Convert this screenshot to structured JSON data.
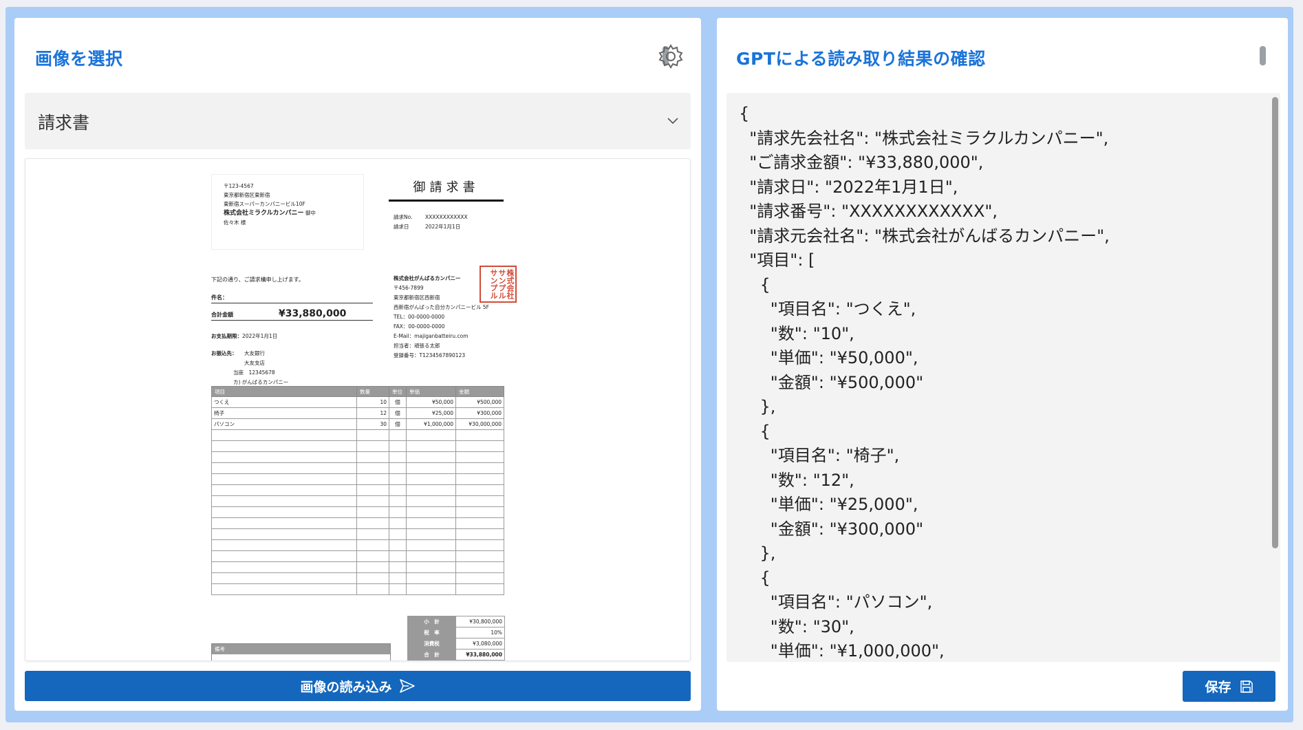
{
  "left_panel": {
    "title": "画像を選択",
    "select_value": "請求書",
    "load_button_label": "画像の読み込み"
  },
  "right_panel": {
    "title": "GPTによる読み取り結果の確認",
    "result_text": "{\n  \"請求先会社名\": \"株式会社ミラクルカンパニー\",\n  \"ご請求金額\": \"¥33,880,000\",\n  \"請求日\": \"2022年1月1日\",\n  \"請求番号\": \"XXXXXXXXXXXX\",\n  \"請求元会社名\": \"株式会社がんばるカンパニー\",\n  \"項目\": [\n    {\n      \"項目名\": \"つくえ\",\n      \"数\": \"10\",\n      \"単価\": \"¥50,000\",\n      \"金額\": \"¥500,000\"\n    },\n    {\n      \"項目名\": \"椅子\",\n      \"数\": \"12\",\n      \"単価\": \"¥25,000\",\n      \"金額\": \"¥300,000\"\n    },\n    {\n      \"項目名\": \"パソコン\",\n      \"数\": \"30\",\n      \"単価\": \"¥1,000,000\",",
    "save_button_label": "保存"
  },
  "invoice": {
    "postal": "〒123-4567",
    "address1": "東京都新宿区東新宿",
    "address2": "東新宿スーパーカンパニービル10F",
    "recipient": "株式会社ミラクルカンパニー",
    "recipient_suffix": "御中",
    "contact": "佐々木 様",
    "title": "御請求書",
    "no_label": "請求No.",
    "no_value": "XXXXXXXXXXXX",
    "date_label": "請求日",
    "date_value": "2022年1月1日",
    "greeting": "下記の通り、ご請求構申し上げます。",
    "subject_label": "件名：",
    "total_label": "合計金額",
    "total_value": "¥33,880,000",
    "due_label": "お支払期限：",
    "due_value": "2022年1月1日",
    "bank_label": "お振込先：",
    "bank_lines": [
      "大友銀行",
      "大友支店",
      "当座　12345678",
      "カ) がんばるカンパニー"
    ],
    "issuer_name": "株式会社がんばるカンパニー",
    "issuer_lines": [
      "〒456-7899",
      "東京都新宿区西新宿",
      "西新宿がんばった自分カンパニービル 5F",
      "TEL：00-0000-0000",
      "FAX：00-0000-0000",
      "E-Mail：majiganbatteiru.com",
      "担当者：頑張る太郎",
      "登録番号：T1234567890123"
    ],
    "seal_text": "株式会社サンプルサンプル",
    "columns": [
      "項目",
      "数量",
      "単位",
      "単価",
      "金額"
    ],
    "rows": [
      [
        "つくえ",
        "10",
        "個",
        "¥50,000",
        "¥500,000"
      ],
      [
        "椅子",
        "12",
        "個",
        "¥25,000",
        "¥300,000"
      ],
      [
        "パソコン",
        "30",
        "個",
        "¥1,000,000",
        "¥30,000,000"
      ]
    ],
    "remarks_label": "備考",
    "summary": [
      [
        "小　計",
        "¥30,800,000"
      ],
      [
        "税　率",
        "10%"
      ],
      [
        "消費税",
        "¥3,080,000"
      ],
      [
        "合　計",
        "¥33,880,000"
      ]
    ]
  },
  "icons": {
    "settings": "gear-icon",
    "dropdown": "chevron-down-icon",
    "send": "send-icon",
    "save": "save-icon"
  }
}
